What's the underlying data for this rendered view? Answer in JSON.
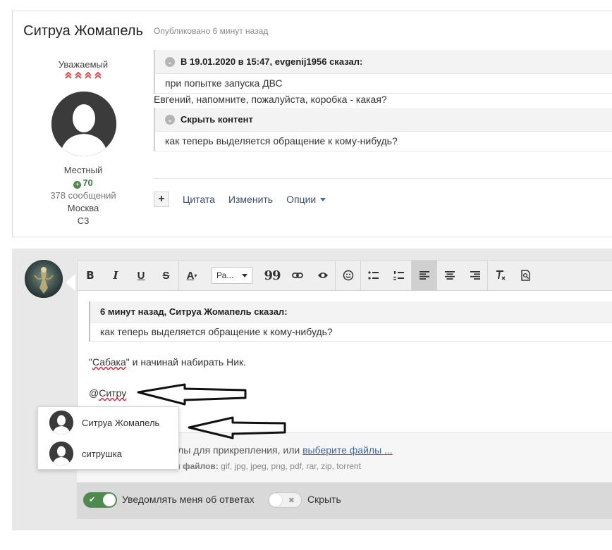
{
  "post": {
    "author_name": "Ситруа Жомапель",
    "author_rank": "Уважаемый",
    "author_group": "Местный",
    "reputation": "70",
    "posts_count": "378 сообщений",
    "city": "Москва",
    "extra": "С3",
    "published": "Опубликовано 6 минут назад",
    "quote1_header": "В 19.01.2020 в 15:47, evgenij1956 сказал:",
    "quote1_body": "при попытке запуска ДВС",
    "text": "Евгений, напомните, пожалуйста, коробка - какая?",
    "quote2_header": "Скрыть контент",
    "quote2_body": "как теперь выделяется обращение к кому-нибудь?",
    "actions": {
      "plus": "+",
      "quote": "Цитата",
      "edit": "Изменить",
      "options": "Опции"
    }
  },
  "toolbar": {
    "bold": "B",
    "italic": "I",
    "underline": "U",
    "strike": "S",
    "font_color": "A",
    "font_select": "Ра...",
    "blockquote": "99"
  },
  "editor": {
    "quote_header": "6 минут назад, Ситруа Жомапель сказал:",
    "quote_body": "как теперь выделяется обращение к кому-нибудь?",
    "line1_word": "Сабака",
    "line1_rest": "\" и начинай набирать Ник.",
    "line1_open": "\"",
    "mention_prefix": "@",
    "mention_text": "Ситру"
  },
  "mention_dropdown": [
    {
      "name": "Ситруа Жомапель"
    },
    {
      "name": "ситрушка"
    }
  ],
  "attach": {
    "line1_text": "файлы для прикрепления, или ",
    "line1_link": "выберите файлы ...",
    "line2_label": "типы файлов:",
    "line2_types": " gif, jpg, jpeg, png, pdf, rar, zip, torrent"
  },
  "footer": {
    "notify_label": "Уведомлять меня об ответах",
    "hide_label": "Скрыть"
  },
  "colors": {
    "accent_green": "#4e8a4e",
    "link_blue": "#3d6aa8",
    "rank_red": "#d9534f"
  }
}
